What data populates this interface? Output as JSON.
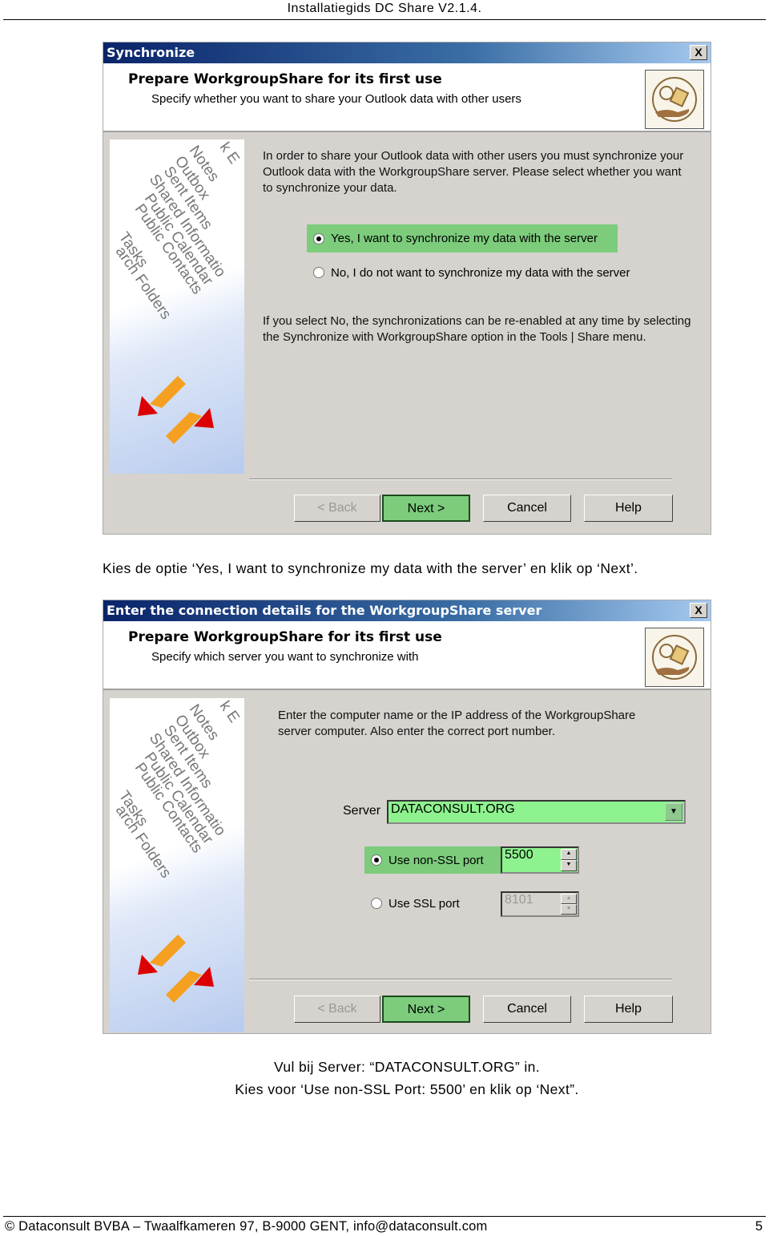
{
  "header": {
    "title": "Installatiegids DC Share V2.1.4."
  },
  "dialog1": {
    "title": "Synchronize",
    "close": "X",
    "heading": "Prepare WorkgroupShare for its first use",
    "subheading": "Specify whether you want to share your Outlook data with other users",
    "intro": "In order to share your Outlook data with other users you must synchronize your Outlook data with the WorkgroupShare server. Please select whether you want to synchronize your data.",
    "options": [
      {
        "label": "Yes, I want to synchronize my data with the server",
        "selected": true
      },
      {
        "label": "No, I do not want to synchronize my data with the server",
        "selected": false
      }
    ],
    "note": "If you select No, the synchronizations can be re-enabled at any time by selecting the Synchronize with WorkgroupShare option in the Tools | Share menu.",
    "buttons": {
      "back": "< Back",
      "next": "Next >",
      "cancel": "Cancel",
      "help": "Help"
    }
  },
  "sidebar_folders": [
    "k E",
    "Notes",
    "Outbox",
    "Sent Items",
    "Shared Informatio",
    "Public Calendar",
    "Public Contacts",
    "Tasks",
    "arch Folders"
  ],
  "caption1": "Kies de optie ‘Yes, I want to synchronize my data with the server’ en klik op ‘Next’.",
  "dialog2": {
    "title": "Enter the connection details for the WorkgroupShare server",
    "close": "X",
    "heading": "Prepare WorkgroupShare for its first use",
    "subheading": "Specify which server you want to synchronize with",
    "intro": "Enter the computer name or the IP address of the WorkgroupShare server computer. Also enter the correct port number.",
    "server_label": "Server",
    "server_value": "DATACONSULT.ORG",
    "non_ssl": {
      "label": "Use non-SSL port",
      "value": "5500",
      "selected": true
    },
    "ssl": {
      "label": "Use SSL port",
      "value": "8101",
      "selected": false
    },
    "buttons": {
      "back": "< Back",
      "next": "Next >",
      "cancel": "Cancel",
      "help": "Help"
    }
  },
  "caption2": "Vul bij Server: “DATACONSULT.ORG” in.",
  "caption3": "Kies voor ‘Use non-SSL Port: 5500’ en klik op ‘Next”.",
  "footer": {
    "text": "© Dataconsult BVBA – Twaalfkameren 97, B-9000 GENT, ",
    "email": "info@dataconsult.com",
    "page": "5"
  },
  "colors": {
    "highlight": "#7ccc7c",
    "titlebar": "#0a246a",
    "dialog_bg": "#d6d3ce"
  }
}
